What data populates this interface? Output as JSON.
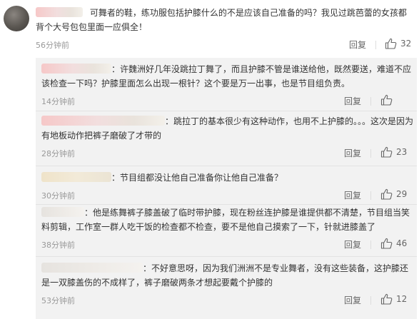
{
  "main_comment": {
    "text": "可舞者的鞋，练功服包括护膝什么的不是应该自己准备的吗？我见过跳芭蕾的女孩都背个大号包包里面一应俱全！",
    "time": "56分钟前",
    "reply_label": "回复",
    "likes": "32"
  },
  "replies": [
    {
      "text": "：许魏洲好几年没跳拉丁舞了，而且护膝不管是谁送给他，既然要送，难道不应该检查一下吗？护膝里面怎么出现一根针？这个要是万一出事，也是节目组负责。",
      "time": "14分钟前",
      "reply_label": "回复",
      "likes": ""
    },
    {
      "text": "：跳拉丁的基本很少有这种动作，也用不上护膝的。。。这次是因为有地板动作把裤子磨破了才带的",
      "time": "28分钟前",
      "reply_label": "回复",
      "likes": "23"
    },
    {
      "text": "：节目组都没让他自己准备你让他自己准备？",
      "time": "30分钟前",
      "reply_label": "回复",
      "likes": "29"
    },
    {
      "text": "：他是练舞裤子膝盖破了临时带护膝，现在粉丝连护膝是谁提供都不清楚，节目组当笑料剪辑，工作室一群人吃干饭的检查都不检查，要不是他自己摸索了一下，针就进膝盖了",
      "time": "38分钟前",
      "reply_label": "回复",
      "likes": "46"
    },
    {
      "text": "：不好意思呀，因为我们洲洲不是专业舞者，没有这些装备，这护膝还是一双膝盖伤的不成样了，裤子磨破两条才想起要戴个护膝的",
      "time": "53分钟前",
      "reply_label": "回复",
      "likes": "12"
    }
  ],
  "colors": {
    "background": "#ffffff",
    "replies_background": "#f2f2f2",
    "text": "#333333",
    "meta": "#999999"
  },
  "icons": {
    "like": "thumbs-up-icon"
  }
}
